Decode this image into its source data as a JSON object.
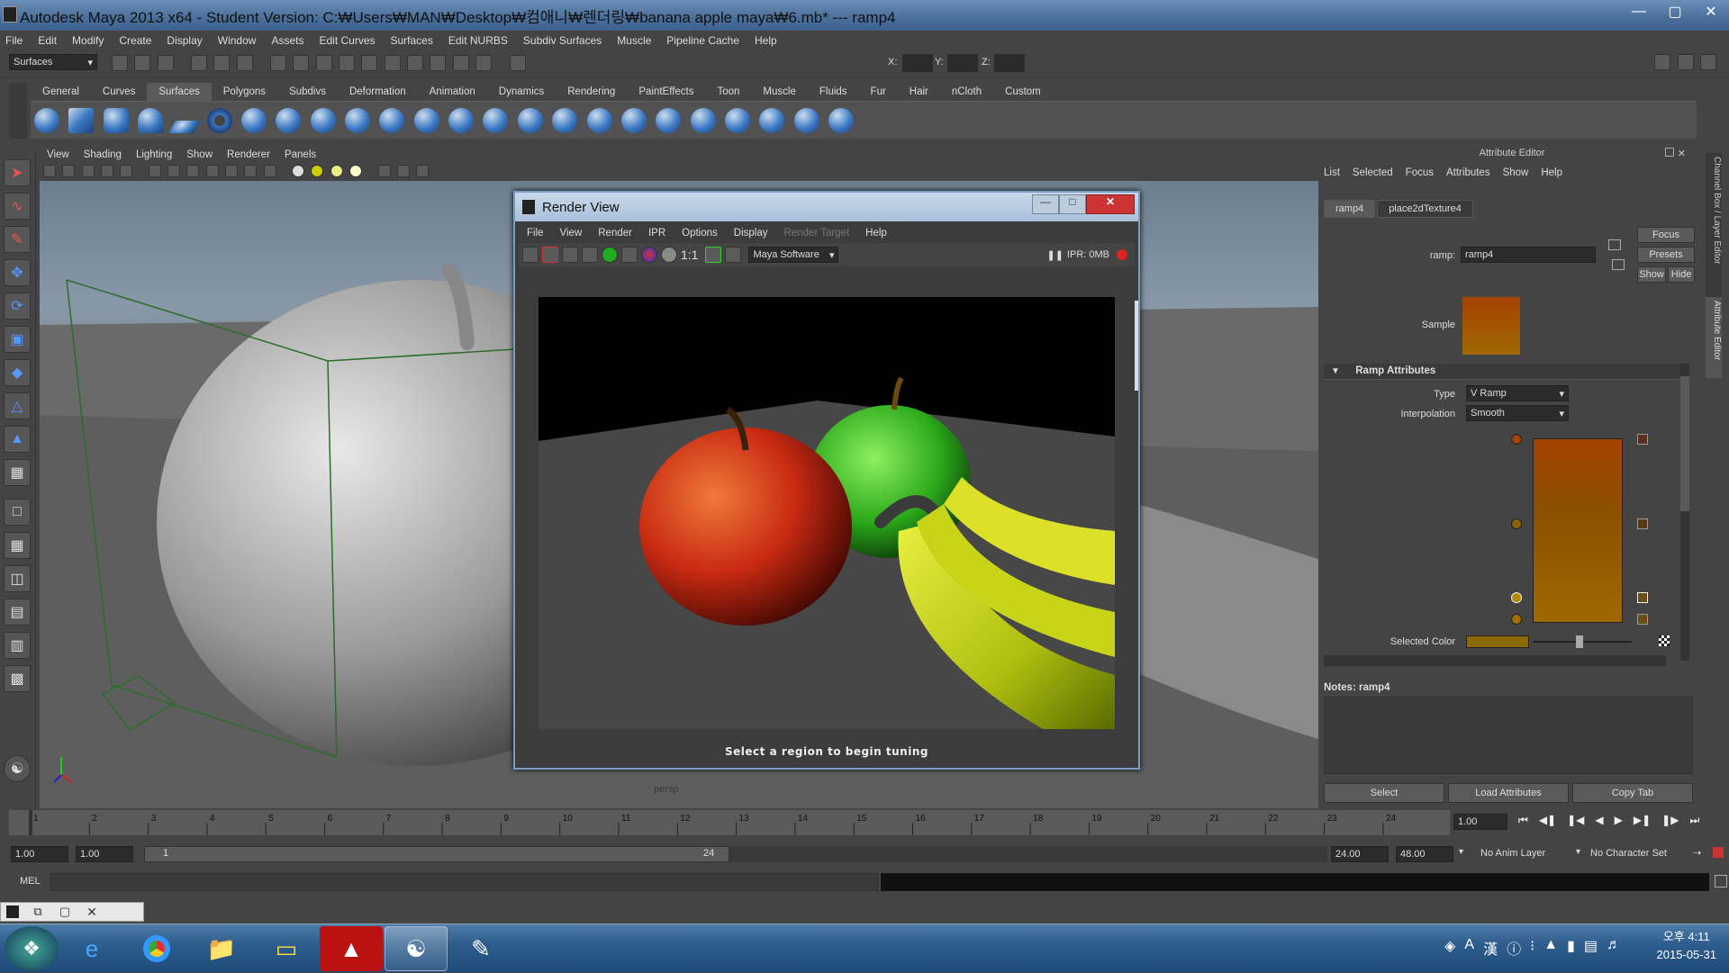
{
  "window": {
    "title": "Autodesk Maya 2013 x64 - Student Version: C:₩Users₩MAN₩Desktop₩컴애니₩렌더링₩banana apple maya₩6.mb*   ---   ramp4"
  },
  "menubar": [
    "File",
    "Edit",
    "Modify",
    "Create",
    "Display",
    "Window",
    "Assets",
    "Edit Curves",
    "Surfaces",
    "Edit NURBS",
    "Subdiv Surfaces",
    "Muscle",
    "Pipeline Cache",
    "Help"
  ],
  "toolbar": {
    "menuset": "Surfaces",
    "x_label": "X:",
    "y_label": "Y:",
    "z_label": "Z:"
  },
  "shelf": {
    "tabs": [
      "General",
      "Curves",
      "Surfaces",
      "Polygons",
      "Subdivs",
      "Deformation",
      "Animation",
      "Dynamics",
      "Rendering",
      "PaintEffects",
      "Toon",
      "Muscle",
      "Fluids",
      "Fur",
      "Hair",
      "nCloth",
      "Custom"
    ],
    "active": "Surfaces"
  },
  "viewport": {
    "menu": [
      "View",
      "Shading",
      "Lighting",
      "Show",
      "Renderer",
      "Panels"
    ],
    "camera_label": "persp"
  },
  "render_view": {
    "title": "Render View",
    "menu": [
      "File",
      "View",
      "Render",
      "IPR",
      "Options",
      "Display",
      "Render Target",
      "Help"
    ],
    "renderer": "Maya Software",
    "ratio": "1:1",
    "ipr_info": "IPR: 0MB",
    "status": "Select a region to begin tuning"
  },
  "attribute_editor": {
    "header": "Attribute Editor",
    "menu": [
      "List",
      "Selected",
      "Focus",
      "Attributes",
      "Show",
      "Help"
    ],
    "tabs": [
      "ramp4",
      "place2dTexture4"
    ],
    "ramp_label": "ramp:",
    "ramp_value": "ramp4",
    "focus_btn": "Focus",
    "presets_btn": "Presets",
    "show_btn": "Show",
    "hide_btn": "Hide",
    "sample_label": "Sample",
    "section": "Ramp Attributes",
    "type_label": "Type",
    "type_value": "V Ramp",
    "interp_label": "Interpolation",
    "interp_value": "Smooth",
    "selected_color_label": "Selected Color",
    "notes": "Notes: ramp4",
    "bottom_buttons": [
      "Select",
      "Load Attributes",
      "Copy Tab"
    ],
    "side_tabs": [
      "Channel Box / Layer Editor",
      "Attribute Editor"
    ]
  },
  "timeline": {
    "ticks": [
      "1",
      "2",
      "3",
      "4",
      "5",
      "6",
      "7",
      "8",
      "9",
      "10",
      "11",
      "12",
      "13",
      "14",
      "15",
      "16",
      "17",
      "18",
      "19",
      "20",
      "21",
      "22",
      "23",
      "24"
    ],
    "current_frame": "1.00"
  },
  "range": {
    "start": "1.00",
    "playback_start": "1.00",
    "slider_start": "1",
    "slider_end": "24",
    "playback_end": "24.00",
    "end": "48.00",
    "anim_layer": "No Anim Layer",
    "character_set": "No Character Set"
  },
  "command": {
    "label": "MEL"
  },
  "taskbar": {
    "time": "오후 4:11",
    "date": "2015-05-31"
  },
  "colors": {
    "accent": "#4a6f9a",
    "panel": "#444444",
    "ramp_top": "#a44200",
    "ramp_bottom": "#a06800"
  }
}
